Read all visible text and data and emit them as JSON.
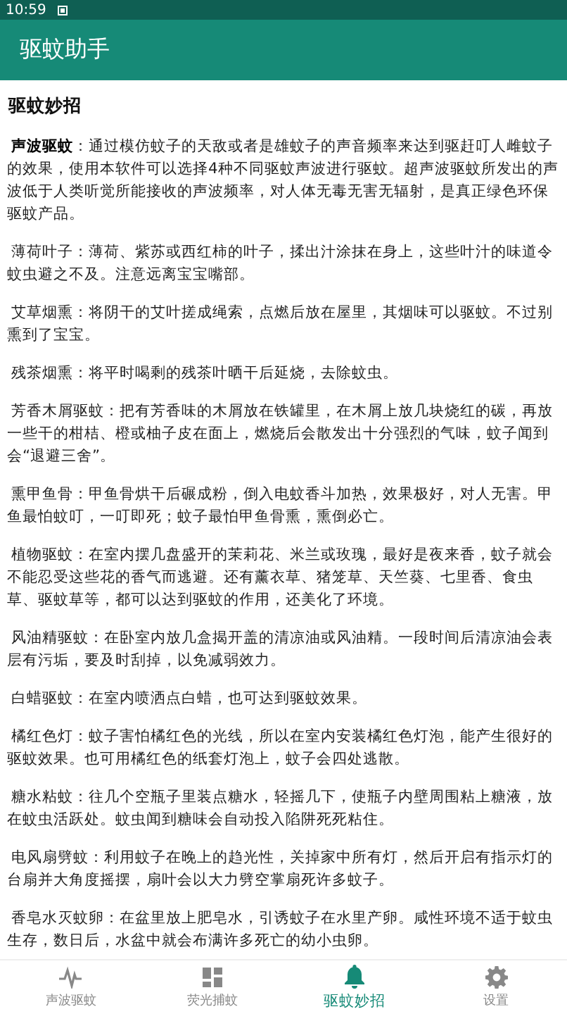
{
  "status_bar": {
    "time": "10:59"
  },
  "app_bar": {
    "title": "驱蚊助手"
  },
  "section_title": "驱蚊妙招",
  "paragraphs": [
    "**声波驱蚊**：通过模仿蚊子的天敌或者是雄蚊子的声音频率来达到驱赶叮人雌蚊子的效果，使用本软件可以选择4种不同驱蚊声波进行驱蚊。超声波驱蚊所发出的声波低于人类听觉所能接收的声波频率，对人体无毒无害无辐射，是真正绿色环保驱蚊产品。",
    "薄荷叶子：薄荷、紫苏或西红柿的叶子，揉出汁涂抹在身上，这些叶汁的味道令蚊虫避之不及。注意远离宝宝嘴部。",
    "艾草烟熏：将阴干的艾叶搓成绳索，点燃后放在屋里，其烟味可以驱蚊。不过别熏到了宝宝。",
    "残茶烟熏：将平时喝剩的残茶叶晒干后延烧，去除蚊虫。",
    "芳香木屑驱蚊：把有芳香味的木屑放在铁罐里，在木屑上放几块烧红的碳，再放一些干的柑桔、橙或柚子皮在面上，燃烧后会散发出十分强烈的气味，蚊子闻到会“退避三舍”。",
    "熏甲鱼骨：甲鱼骨烘干后碾成粉，倒入电蚊香斗加热，效果极好，对人无害。甲鱼最怕蚊叮，一叮即死；蚊子最怕甲鱼骨熏，熏倒必亡。",
    "植物驱蚊：在室内摆几盘盛开的茉莉花、米兰或玫瑰，最好是夜来香，蚊子就会不能忍受这些花的香气而逃避。还有薰衣草、猪笼草、天竺葵、七里香、食虫草、驱蚊草等，都可以达到驱蚊的作用，还美化了环境。",
    "风油精驱蚊：在卧室内放几盒揭开盖的清凉油或风油精。一段时间后清凉油会表层有污垢，要及时刮掉，以免减弱效力。",
    "白蜡驱蚊：在室内喷洒点白蜡，也可达到驱蚊效果。",
    "橘红色灯：蚊子害怕橘红色的光线，所以在室内安装橘红色灯泡，能产生很好的驱蚊效果。也可用橘红色的纸套灯泡上，蚊子会四处逃散。",
    "糖水粘蚊：往几个空瓶子里装点糖水，轻摇几下，使瓶子内壁周围粘上糖液，放在蚊虫活跃处。蚊虫闻到糖味会自动投入陷阱死死粘住。",
    "电风扇劈蚊：利用蚊子在晚上的趋光性，关掉家中所有灯，然后开启有指示灯的台扇并大角度摇摆，扇叶会以大力劈空掌扇死许多蚊子。",
    "香皂水灭蚊卵：在盆里放上肥皂水，引诱蚊子在水里产卵。咸性环境不适于蚊虫生存，数日后，水盆中就会布满许多死亡的幼小虫卵。"
  ],
  "bottom_nav": [
    {
      "label": "声波驱蚊",
      "selected": false
    },
    {
      "label": "荧光捕蚊",
      "selected": false
    },
    {
      "label": "驱蚊妙招",
      "selected": true
    },
    {
      "label": "设置",
      "selected": false
    }
  ]
}
